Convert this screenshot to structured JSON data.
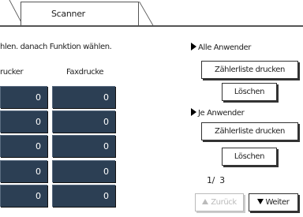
{
  "tabs": {
    "active_label": "Scanner"
  },
  "instruction": "hlen. danach Funktion wählen.",
  "columns": {
    "left": "rucker",
    "right": "Faxdrucke"
  },
  "counters": {
    "left": [
      "0",
      "0",
      "0",
      "0",
      "0"
    ],
    "right": [
      "0",
      "0",
      "0",
      "0",
      "0"
    ]
  },
  "all_users": {
    "label": "Alle Anwender",
    "print_button": "Zählerliste drucken",
    "clear_button": "Löschen"
  },
  "per_user": {
    "label": "Je Anwender",
    "print_button": "Zählerliste drucken",
    "clear_button": "Löschen"
  },
  "pagination": {
    "current": "1/",
    "total": "3"
  },
  "nav": {
    "back_label": "Zurück",
    "next_label": "Weiter"
  }
}
